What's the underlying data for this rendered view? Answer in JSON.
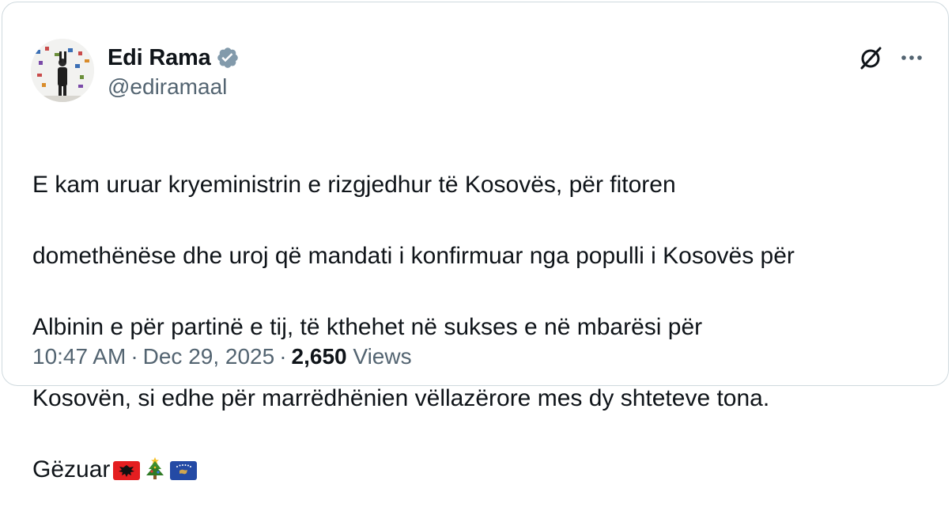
{
  "author": {
    "name": "Edi Rama",
    "handle": "@ediramaal",
    "verified": true
  },
  "tweet": {
    "lines": [
      "E kam uruar kryeministrin e rizgjedhur të Kosovës, për fitoren",
      "domethënëse dhe uroj që mandati i konfirmuar nga populli i Kosovës për",
      "Albinin e për partinë e tij, të kthehet në sukses e në mbarësi për",
      "Kosovën, si edhe për marrëdhënien vëllazërore mes dy shteteve tona.",
      "Gëzuar"
    ],
    "emojis": [
      "albania-flag-icon",
      "christmas-tree-icon",
      "kosovo-flag-icon"
    ]
  },
  "meta": {
    "time": "10:47 AM",
    "separator": "·",
    "date": "Dec 29, 2025",
    "views_count": "2,650",
    "views_label": "Views"
  },
  "colors": {
    "text": "#0f1419",
    "secondary": "#536471",
    "border": "#cfd9de",
    "verified_badge": "#829aab"
  }
}
